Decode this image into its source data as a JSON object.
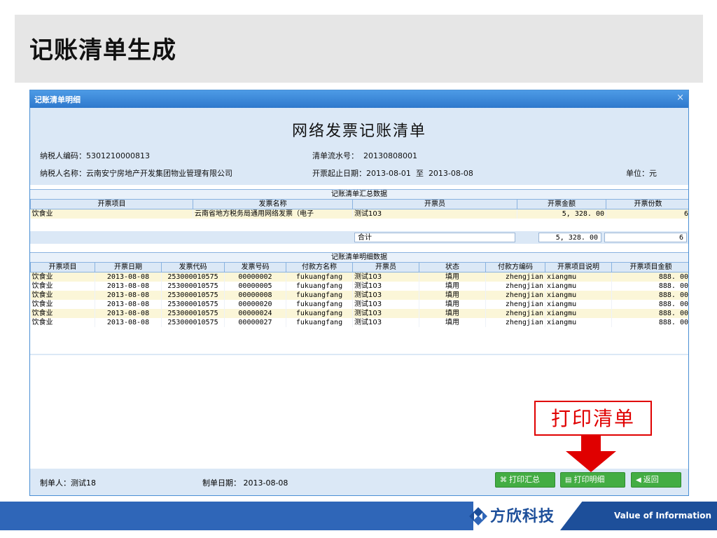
{
  "slide": {
    "title": "记账清单生成"
  },
  "window": {
    "title": "记账清单明细",
    "close": "×"
  },
  "document": {
    "title": "网络发票记账清单",
    "taxpayer_id_label": "纳税人编码：",
    "taxpayer_id": "5301210000813",
    "taxpayer_name_label": "纳税人名称：",
    "taxpayer_name": "云南安宁房地产开发集团物业管理有限公司",
    "serial_label": "清单流水号：",
    "serial": "20130808001",
    "period_label": "开票起止日期：",
    "period_start": "2013-08-01",
    "period_to": "至",
    "period_end": "2013-08-08",
    "unit": "单位：元"
  },
  "summary": {
    "section_title": "记账清单汇总数据",
    "headers": [
      "开票项目",
      "发票名称",
      "开票员",
      "开票金额",
      "开票份数"
    ],
    "row": {
      "item": "饮食业",
      "invoice_name": "云南省地方税务局通用网络发票（电子",
      "issuer": "测试103",
      "amount": "5, 328. 00",
      "count": "6"
    },
    "total_label": "合计",
    "total_amount": "5, 328. 00",
    "total_count": "6"
  },
  "detail": {
    "section_title": "记账清单明细数据",
    "headers": [
      "开票项目",
      "开票日期",
      "发票代码",
      "发票号码",
      "付款方名称",
      "开票员",
      "状态",
      "付款方编码",
      "开票项目说明",
      "开票项目金额"
    ],
    "rows": [
      [
        "饮食业",
        "2013-08-08",
        "253000010575",
        "00000002",
        "fukuangfang",
        "测试103",
        "填用",
        "zhengjian",
        "xiangmu",
        "888. 00"
      ],
      [
        "饮食业",
        "2013-08-08",
        "253000010575",
        "00000005",
        "fukuangfang",
        "测试103",
        "填用",
        "zhengjian",
        "xiangmu",
        "888. 00"
      ],
      [
        "饮食业",
        "2013-08-08",
        "253000010575",
        "00000008",
        "fukuangfang",
        "测试103",
        "填用",
        "zhengjian",
        "xiangmu",
        "888. 00"
      ],
      [
        "饮食业",
        "2013-08-08",
        "253000010575",
        "00000020",
        "fukuangfang",
        "测试103",
        "填用",
        "zhengjian",
        "xiangmu",
        "888. 00"
      ],
      [
        "饮食业",
        "2013-08-08",
        "253000010575",
        "00000024",
        "fukuangfang",
        "测试103",
        "填用",
        "zhengjian",
        "xiangmu",
        "888. 00"
      ],
      [
        "饮食业",
        "2013-08-08",
        "253000010575",
        "00000027",
        "fukuangfang",
        "测试103",
        "填用",
        "zhengjian",
        "xiangmu",
        "888. 00"
      ]
    ]
  },
  "footer": {
    "maker_label": "制单人：",
    "maker": "测试18",
    "date_label": "制单日期：",
    "date": "2013-08-08",
    "btn_print_summary": "打印汇总",
    "btn_print_detail": "打印明细",
    "btn_back": "返回"
  },
  "callout": {
    "text": "打印清单"
  },
  "branding": {
    "company": "方欣科技",
    "tagline": "Value of Information"
  },
  "colors": {
    "accent_blue": "#2f66b8",
    "window_border": "#4a8fd4",
    "green_button": "#43ad43",
    "callout_red": "#e00000"
  }
}
